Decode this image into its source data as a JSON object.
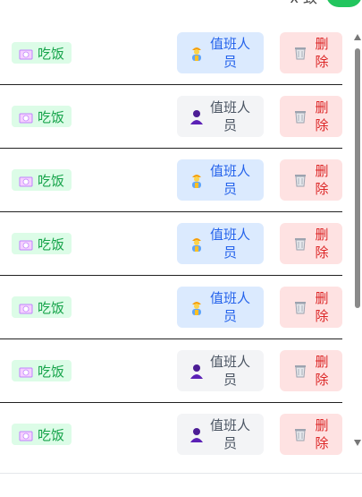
{
  "header": {
    "partial_text": "x 致"
  },
  "rows": [
    {
      "tag_label": "吃饭",
      "duty_label": "值班人员",
      "duty_state": "active",
      "delete_label": "删除"
    },
    {
      "tag_label": "吃饭",
      "duty_label": "值班人员",
      "duty_state": "inactive",
      "delete_label": "删除"
    },
    {
      "tag_label": "吃饭",
      "duty_label": "值班人员",
      "duty_state": "active",
      "delete_label": "删除"
    },
    {
      "tag_label": "吃饭",
      "duty_label": "值班人员",
      "duty_state": "active",
      "delete_label": "删除"
    },
    {
      "tag_label": "吃饭",
      "duty_label": "值班人员",
      "duty_state": "active",
      "delete_label": "删除"
    },
    {
      "tag_label": "吃饭",
      "duty_label": "值班人员",
      "duty_state": "inactive",
      "delete_label": "删除"
    },
    {
      "tag_label": "吃饭",
      "duty_label": "值班人员",
      "duty_state": "inactive",
      "delete_label": "删除"
    }
  ],
  "colors": {
    "tag_bg": "#dcfce7",
    "tag_text": "#16a34a",
    "duty_active_bg": "#dbeafe",
    "duty_active_text": "#2563eb",
    "duty_inactive_bg": "#f3f4f6",
    "duty_inactive_text": "#4b5563",
    "delete_bg": "#fee2e2",
    "delete_text": "#dc2626"
  },
  "icons": {
    "tag": "plate-icon",
    "duty_active": "worker-icon",
    "duty_inactive": "person-icon",
    "delete": "trash-icon"
  }
}
